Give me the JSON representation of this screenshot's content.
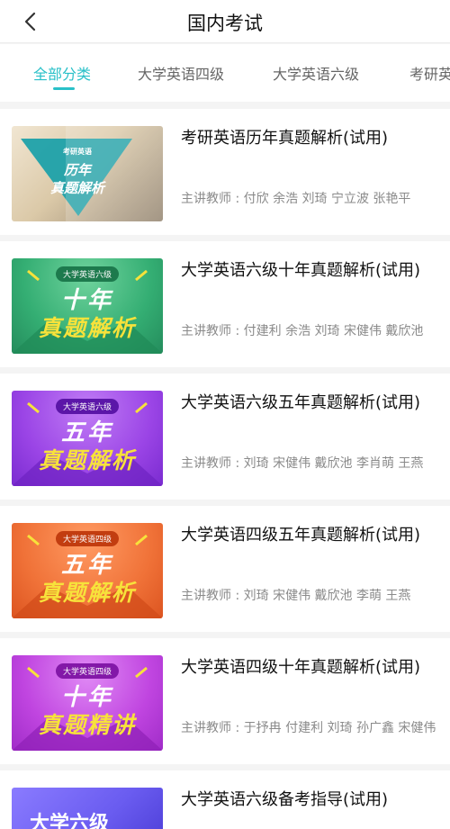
{
  "header": {
    "title": "国内考试"
  },
  "tabs": [
    {
      "label": "全部分类",
      "active": true
    },
    {
      "label": "大学英语四级",
      "active": false
    },
    {
      "label": "大学英语六级",
      "active": false
    },
    {
      "label": "考研英",
      "active": false
    }
  ],
  "courses": [
    {
      "title": "考研英语历年真题解析(试用)",
      "teachers": "主讲教师 : 付欣 余浩 刘琦 宁立波 张艳平",
      "thumb": {
        "pill": "考研英语",
        "line1": "历年",
        "line2": "真题解析",
        "bg": "#3aa5b4",
        "accent": "#1ea0a8"
      }
    },
    {
      "title": "大学英语六级十年真题解析(试用)",
      "teachers": "主讲教师 : 付建利 余浩 刘琦 宋健伟 戴欣池",
      "thumb": {
        "pill": "大学英语六级",
        "line1": "十年",
        "line2": "真题解析",
        "bg": "#3bb37a",
        "accent": "#f7e23b"
      }
    },
    {
      "title": "大学英语六级五年真题解析(试用)",
      "teachers": "主讲教师 : 刘琦 宋健伟 戴欣池 李肖萌 王燕",
      "thumb": {
        "pill": "大学英语六级",
        "line1": "五年",
        "line2": "真题解析",
        "bg": "#9b45e6",
        "accent": "#f7e23b"
      }
    },
    {
      "title": "大学英语四级五年真题解析(试用)",
      "teachers": "主讲教师 : 刘琦 宋健伟 戴欣池 李萌 王燕",
      "thumb": {
        "pill": "大学英语四级",
        "line1": "五年",
        "line2": "真题解析",
        "bg": "#f07238",
        "accent": "#f7e23b"
      }
    },
    {
      "title": "大学英语四级十年真题解析(试用)",
      "teachers": "主讲教师 : 于抒冉 付建利 刘琦 孙广鑫 宋健伟",
      "thumb": {
        "pill": "大学英语四级",
        "line1": "十年",
        "line2": "真题精讲",
        "bg": "#c045e0",
        "accent": "#f7e23b"
      }
    },
    {
      "title": "大学英语六级备考指导(试用)",
      "teachers": "",
      "thumb": {
        "pill": "",
        "line1": "大学六级",
        "line2": "",
        "bg": "#6a5cf0",
        "accent": "#f7e23b"
      }
    }
  ]
}
